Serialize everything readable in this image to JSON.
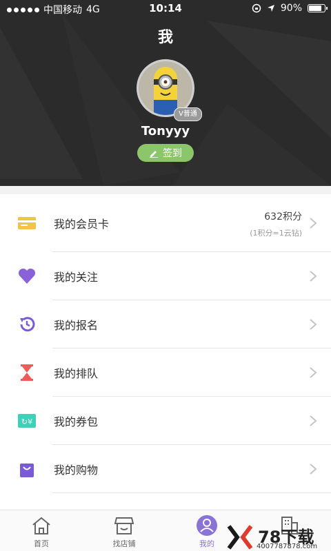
{
  "status_bar": {
    "carrier": "中国移动",
    "network": "4G",
    "time": "10:14",
    "battery": "90%",
    "battery_level": 0.9
  },
  "header": {
    "title": "我",
    "username": "Tonyyy",
    "badge": "V普通",
    "checkin_label": "签到"
  },
  "menu": {
    "items": [
      {
        "label": "我的会员卡",
        "icon": "card-icon",
        "color": "#f3c547",
        "points": "632积分",
        "points_note": "(1积分=1云钻)"
      },
      {
        "label": "我的关注",
        "icon": "heart-icon",
        "color": "#8a62d8"
      },
      {
        "label": "我的报名",
        "icon": "history-clock-icon",
        "color": "#7a5ad6"
      },
      {
        "label": "我的排队",
        "icon": "hourglass-icon",
        "color": "#ef5a5a"
      },
      {
        "label": "我的券包",
        "icon": "coupon-icon",
        "color": "#3ed0b8"
      },
      {
        "label": "我的购物",
        "icon": "shopping-bag-icon",
        "color": "#7a5ad6"
      }
    ]
  },
  "tabbar": {
    "tabs": [
      {
        "label": "首页",
        "icon": "home-icon"
      },
      {
        "label": "找店铺",
        "icon": "store-icon"
      },
      {
        "label": "我的",
        "icon": "profile-icon",
        "active": true
      },
      {
        "label": "",
        "icon": "building-icon"
      }
    ],
    "accent": "#8a73d6"
  },
  "watermark": {
    "brand": "78下载",
    "site": "4007787878.com"
  }
}
